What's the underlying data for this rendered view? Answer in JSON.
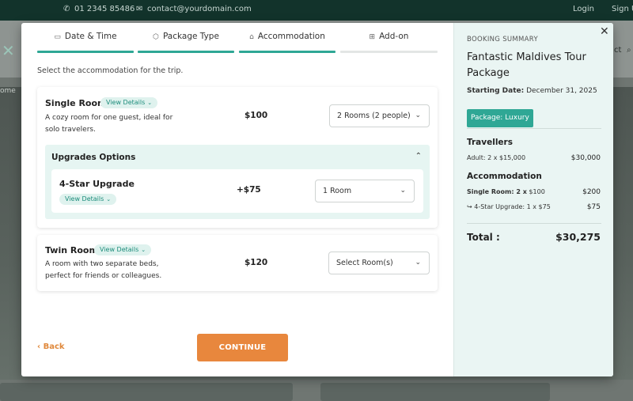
{
  "background": {
    "phone": "01 2345 85486",
    "email": "contact@yourdomain.com",
    "login": "Login",
    "signup": "Sign U",
    "nav_fragment": "ct",
    "breadcrumb_fragment": "ome"
  },
  "tabs": [
    {
      "label": "Date & Time",
      "icon": "calendar-icon",
      "glyph": "▭",
      "state": "complete"
    },
    {
      "label": "Package Type",
      "icon": "package-icon",
      "glyph": "⬡",
      "state": "complete"
    },
    {
      "label": "Accommodation",
      "icon": "bed-icon",
      "glyph": "⌂",
      "state": "active"
    },
    {
      "label": "Add-on",
      "icon": "grid-icon",
      "glyph": "⊞",
      "state": "inactive"
    }
  ],
  "intro": "Select the accommodation for the trip.",
  "rooms": {
    "single": {
      "title": "Single Room",
      "view_details": "View Details",
      "description": "A cozy room for one guest, ideal for solo travelers.",
      "price": "$100",
      "selected": "2 Rooms (2 people)"
    },
    "upgrades_title": "Upgrades Options",
    "upgrade": {
      "title": "4-Star Upgrade",
      "view_details": "View Details",
      "price": "+$75",
      "selected": "1 Room"
    },
    "twin": {
      "title": "Twin Room",
      "view_details": "View Details",
      "description": "A room with two separate beds, perfect for friends or colleagues.",
      "price": "$120",
      "selected": "Select Room(s)"
    }
  },
  "actions": {
    "back": "Back",
    "continue": "CONTINUE"
  },
  "summary": {
    "label": "BOOKING SUMMARY",
    "title": "Fantastic Maldives Tour Package",
    "starting_date_label": "Starting Date:",
    "starting_date": "December 31, 2025",
    "package_badge": "Package: Luxury",
    "travellers_heading": "Travellers",
    "adult_line": "Adult: 2 x $15,000",
    "adult_total": "$30,000",
    "accommodation_heading": "Accommodation",
    "single_line_label": "Single Room: 2 x",
    "single_line_price": "$100",
    "single_total": "$200",
    "upgrade_line": "↪ 4-Star Upgrade: 1 x $75",
    "upgrade_total": "$75",
    "total_label": "Total :",
    "total_value": "$30,275"
  },
  "colors": {
    "accent": "#2fa795",
    "cta": "#e8873d",
    "summary_bg": "#eaf5f3"
  }
}
